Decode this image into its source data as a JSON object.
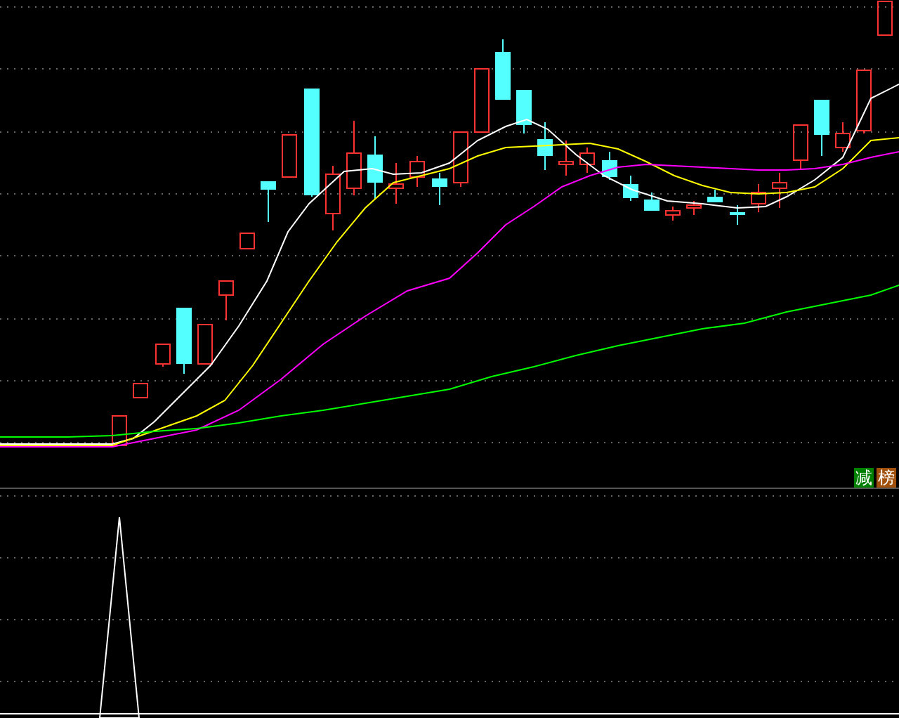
{
  "main_chart": {
    "badges": [
      {
        "text": "减",
        "color": "#008000"
      },
      {
        "text": "榜",
        "color": "#a0500a"
      }
    ]
  }
}
